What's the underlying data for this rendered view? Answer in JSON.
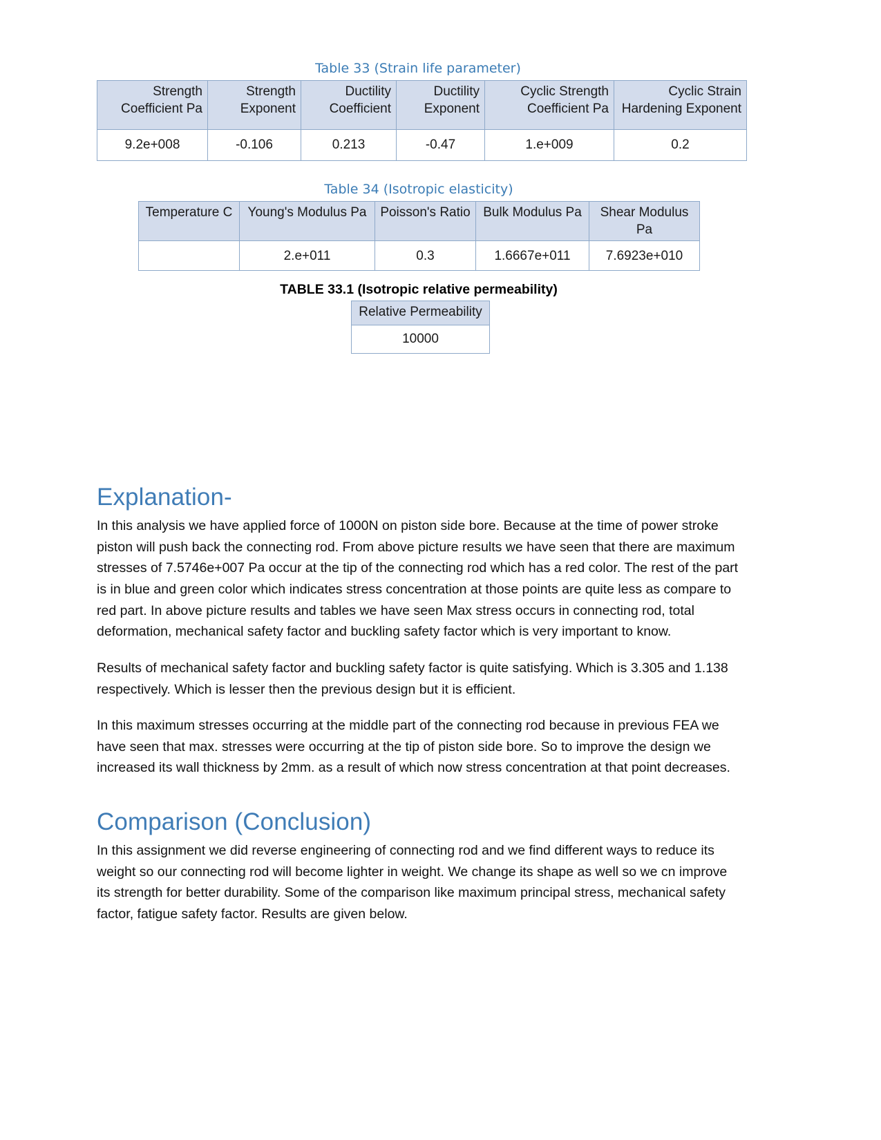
{
  "document": {
    "tables": [
      {
        "id": "table-33",
        "caption": "Table 33 (Strain life parameter)",
        "headers": [
          "Strength Coefficient Pa",
          "Strength Exponent",
          "Ductility Coefficient",
          "Ductility Exponent",
          "Cyclic Strength Coefficient Pa",
          "Cyclic Strain Hardening Exponent"
        ],
        "rows": [
          [
            "9.2e+008",
            "-0.106",
            "0.213",
            "-0.47",
            "1.e+009",
            "0.2"
          ]
        ]
      },
      {
        "id": "table-34",
        "caption": "Table 34 (Isotropic elasticity)",
        "headers": [
          "Temperature C",
          "Young's Modulus Pa",
          "Poisson's Ratio",
          "Bulk Modulus Pa",
          "Shear Modulus Pa"
        ],
        "rows": [
          [
            "",
            "2.e+011",
            "0.3",
            "1.6667e+011",
            "7.6923e+010"
          ]
        ]
      },
      {
        "id": "table-33-1",
        "caption": "TABLE 33.1 (Isotropic relative permeability)",
        "headers": [
          "Relative Permeability"
        ],
        "rows": [
          [
            "10000"
          ]
        ]
      }
    ],
    "sections": [
      {
        "heading": "Explanation-",
        "paragraphs": [
          "In this analysis we have applied force of 1000N on piston side bore. Because at the time of power stroke piston will push back the connecting rod. From above picture results we have seen that there are maximum stresses of 7.5746e+007 Pa occur at the tip of the connecting rod which has a red color. The rest of the part is in blue and green color which indicates stress concentration at those points are quite less as compare to red part. In above picture results and tables we have seen Max stress occurs in connecting rod, total deformation, mechanical safety factor and buckling safety factor which is very important to know.",
          "Results of mechanical safety factor and buckling safety factor is quite satisfying. Which is 3.305 and 1.138 respectively. Which is lesser then the previous design but it is efficient.",
          "In this maximum stresses occurring at the middle part of the connecting rod because in previous FEA we have seen that max. stresses were occurring at the tip of piston side bore. So to improve the design we increased its wall thickness by 2mm. as a result of which now stress concentration at that point decreases."
        ]
      },
      {
        "heading": "Comparison (Conclusion)",
        "paragraphs": [
          "In this assignment we did reverse engineering of connecting rod and we find different ways to reduce its weight so our connecting rod will become lighter in weight. We change its shape as well so we cn improve its strength for better durability. Some of the comparison like maximum principal stress, mechanical safety factor, fatigue safety factor. Results are given below."
        ]
      }
    ],
    "colors": {
      "heading_blue": "#3f7cb6",
      "caption_blue": "#3b7cb5",
      "table_header_fill": "#d3dcec",
      "table_border": "#8ea9c9"
    }
  }
}
